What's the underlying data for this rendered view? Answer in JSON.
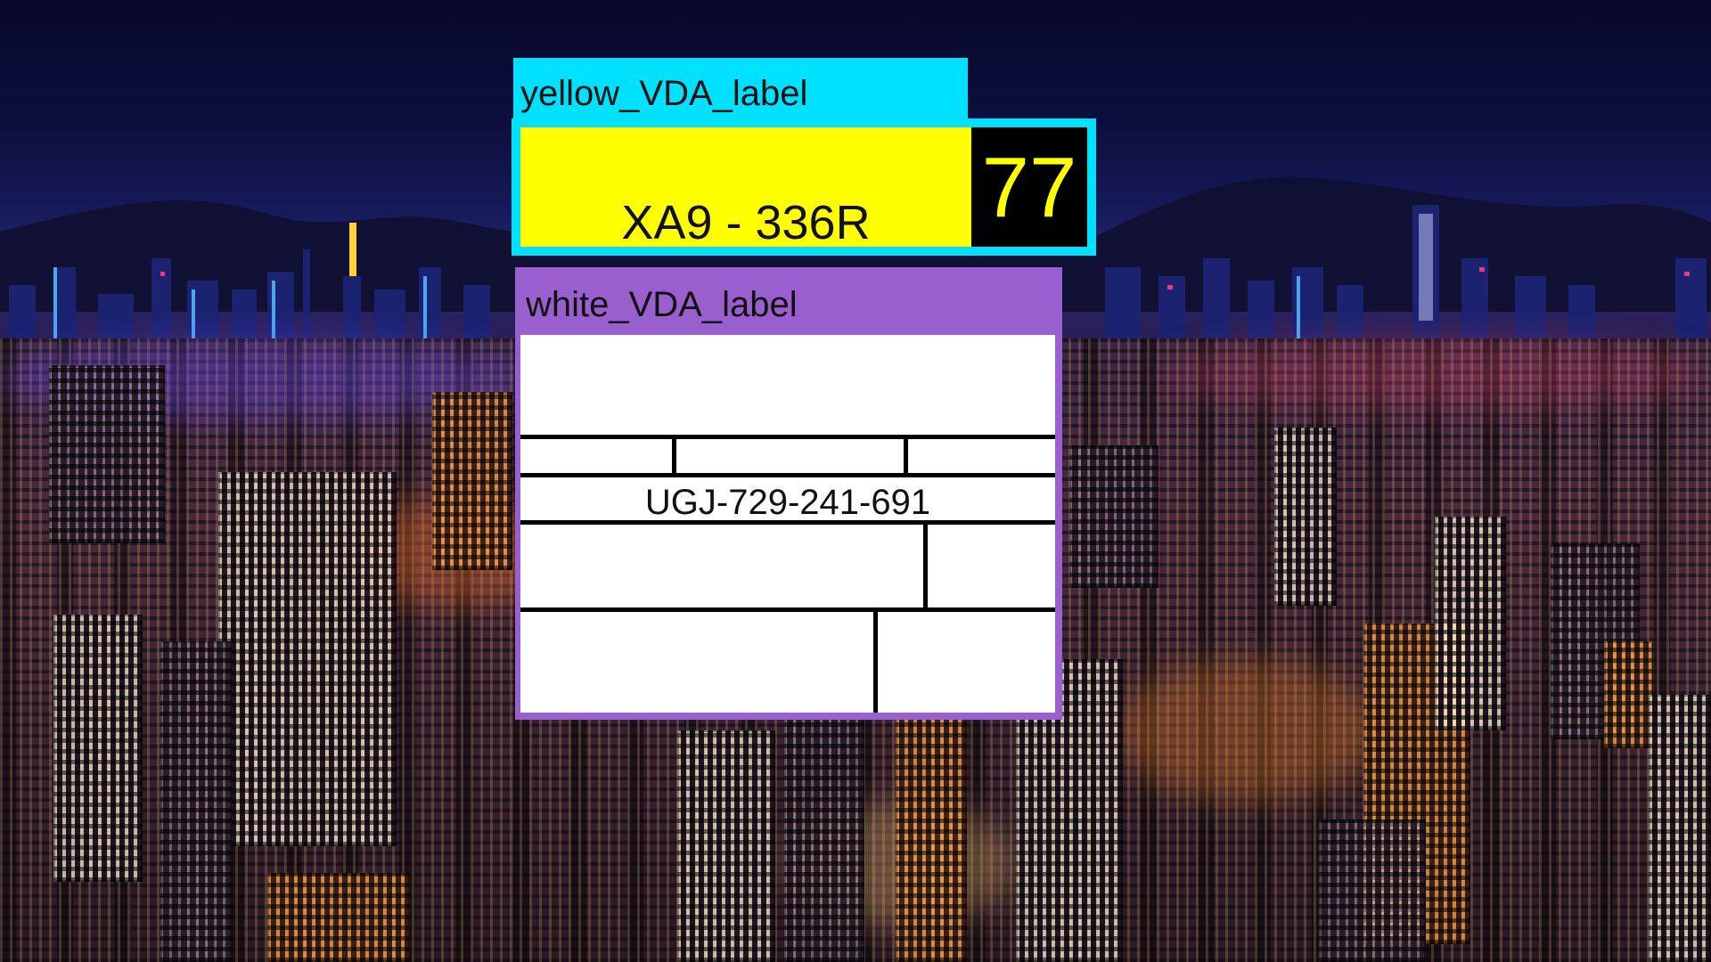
{
  "yellow_label": {
    "tag": "yellow_VDA_label",
    "plate": "XA9 - 336R",
    "number": "77",
    "colors": {
      "tag_bg": "#00e1ff",
      "body": "#ffff00",
      "number_bg": "#000000",
      "number_text": "#ffff00"
    }
  },
  "white_label": {
    "tag": "white_VDA_label",
    "code": "UGJ-729-241-691",
    "colors": {
      "tag_bg": "#9a5fcf",
      "body": "#ffffff",
      "lines": "#000000"
    }
  },
  "background": {
    "description_icon": "night-city-skyline"
  }
}
